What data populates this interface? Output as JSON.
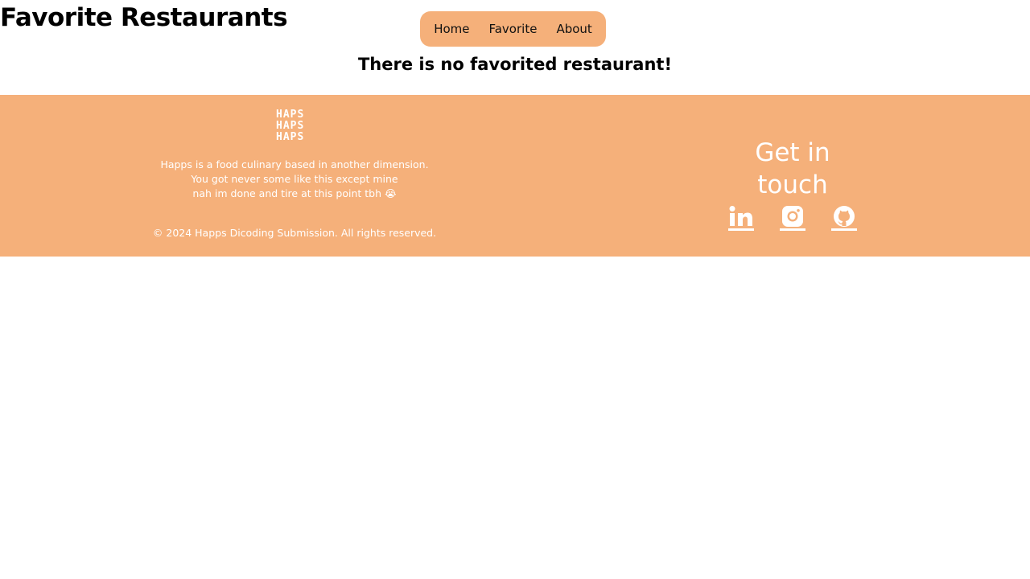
{
  "page": {
    "title": "Favorite Restaurants"
  },
  "nav": {
    "items": [
      {
        "label": "Home"
      },
      {
        "label": "Favorite"
      },
      {
        "label": "About"
      }
    ]
  },
  "main": {
    "empty_message": "There is no favorited restaurant!"
  },
  "footer": {
    "logo_text": [
      "HAPS",
      "HAPS",
      "HAPS"
    ],
    "about_lines": [
      "Happs is a food culinary based in another dimension.",
      "You got never some like this except mine",
      "nah im done and tire at this point tbh 😭"
    ],
    "copyright": "© 2024 Happs Dicoding Submission. All rights reserved.",
    "contact_title": "Get in touch",
    "socials": [
      {
        "icon": "linkedin-icon"
      },
      {
        "icon": "instagram-icon"
      },
      {
        "icon": "github-icon"
      }
    ]
  },
  "colors": {
    "accent": "#f5b07a",
    "footer_text": "#ffffff"
  }
}
